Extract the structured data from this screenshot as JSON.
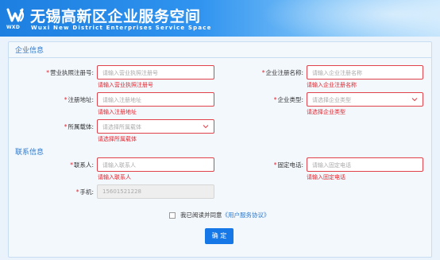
{
  "header": {
    "title": "无锡高新区企业服务空间",
    "subtitle": "Wuxi New District Enterprises Service Space",
    "logo_text": "WXD"
  },
  "enterprise_section": {
    "title": "企业信息",
    "license_no": {
      "label": "营业执照注册号:",
      "placeholder": "请输入营业执照注册号",
      "error": "请输入营业执照注册号"
    },
    "company_name": {
      "label": "企业注册名称:",
      "placeholder": "请输入企业注册名称",
      "error": "请输入企业注册名称"
    },
    "address": {
      "label": "注册地址:",
      "placeholder": "请输入注册地址",
      "error": "请输入注册地址"
    },
    "company_type": {
      "label": "企业类型:",
      "placeholder": "请选择企业类型",
      "error": "请选择企业类型"
    },
    "carrier": {
      "label": "所属载体:",
      "placeholder": "请选择所属载体",
      "error": "请选择所属载体"
    }
  },
  "contact_section": {
    "title": "联系信息",
    "contact": {
      "label": "联系人:",
      "placeholder": "请输入联系人",
      "error": "请输入联系人"
    },
    "phone": {
      "label": "固定电话:",
      "placeholder": "请输入固定电话",
      "error": "请输入固定电话"
    },
    "mobile": {
      "label": "手机:",
      "value": "15601521228"
    }
  },
  "agreement": {
    "text": "我已阅读并同意",
    "link": "《用户服务协议》",
    "checked": false
  },
  "submit_label": "确 定",
  "colors": {
    "accent": "#1677e6",
    "error": "#e0262d",
    "section_title": "#3278c8"
  }
}
